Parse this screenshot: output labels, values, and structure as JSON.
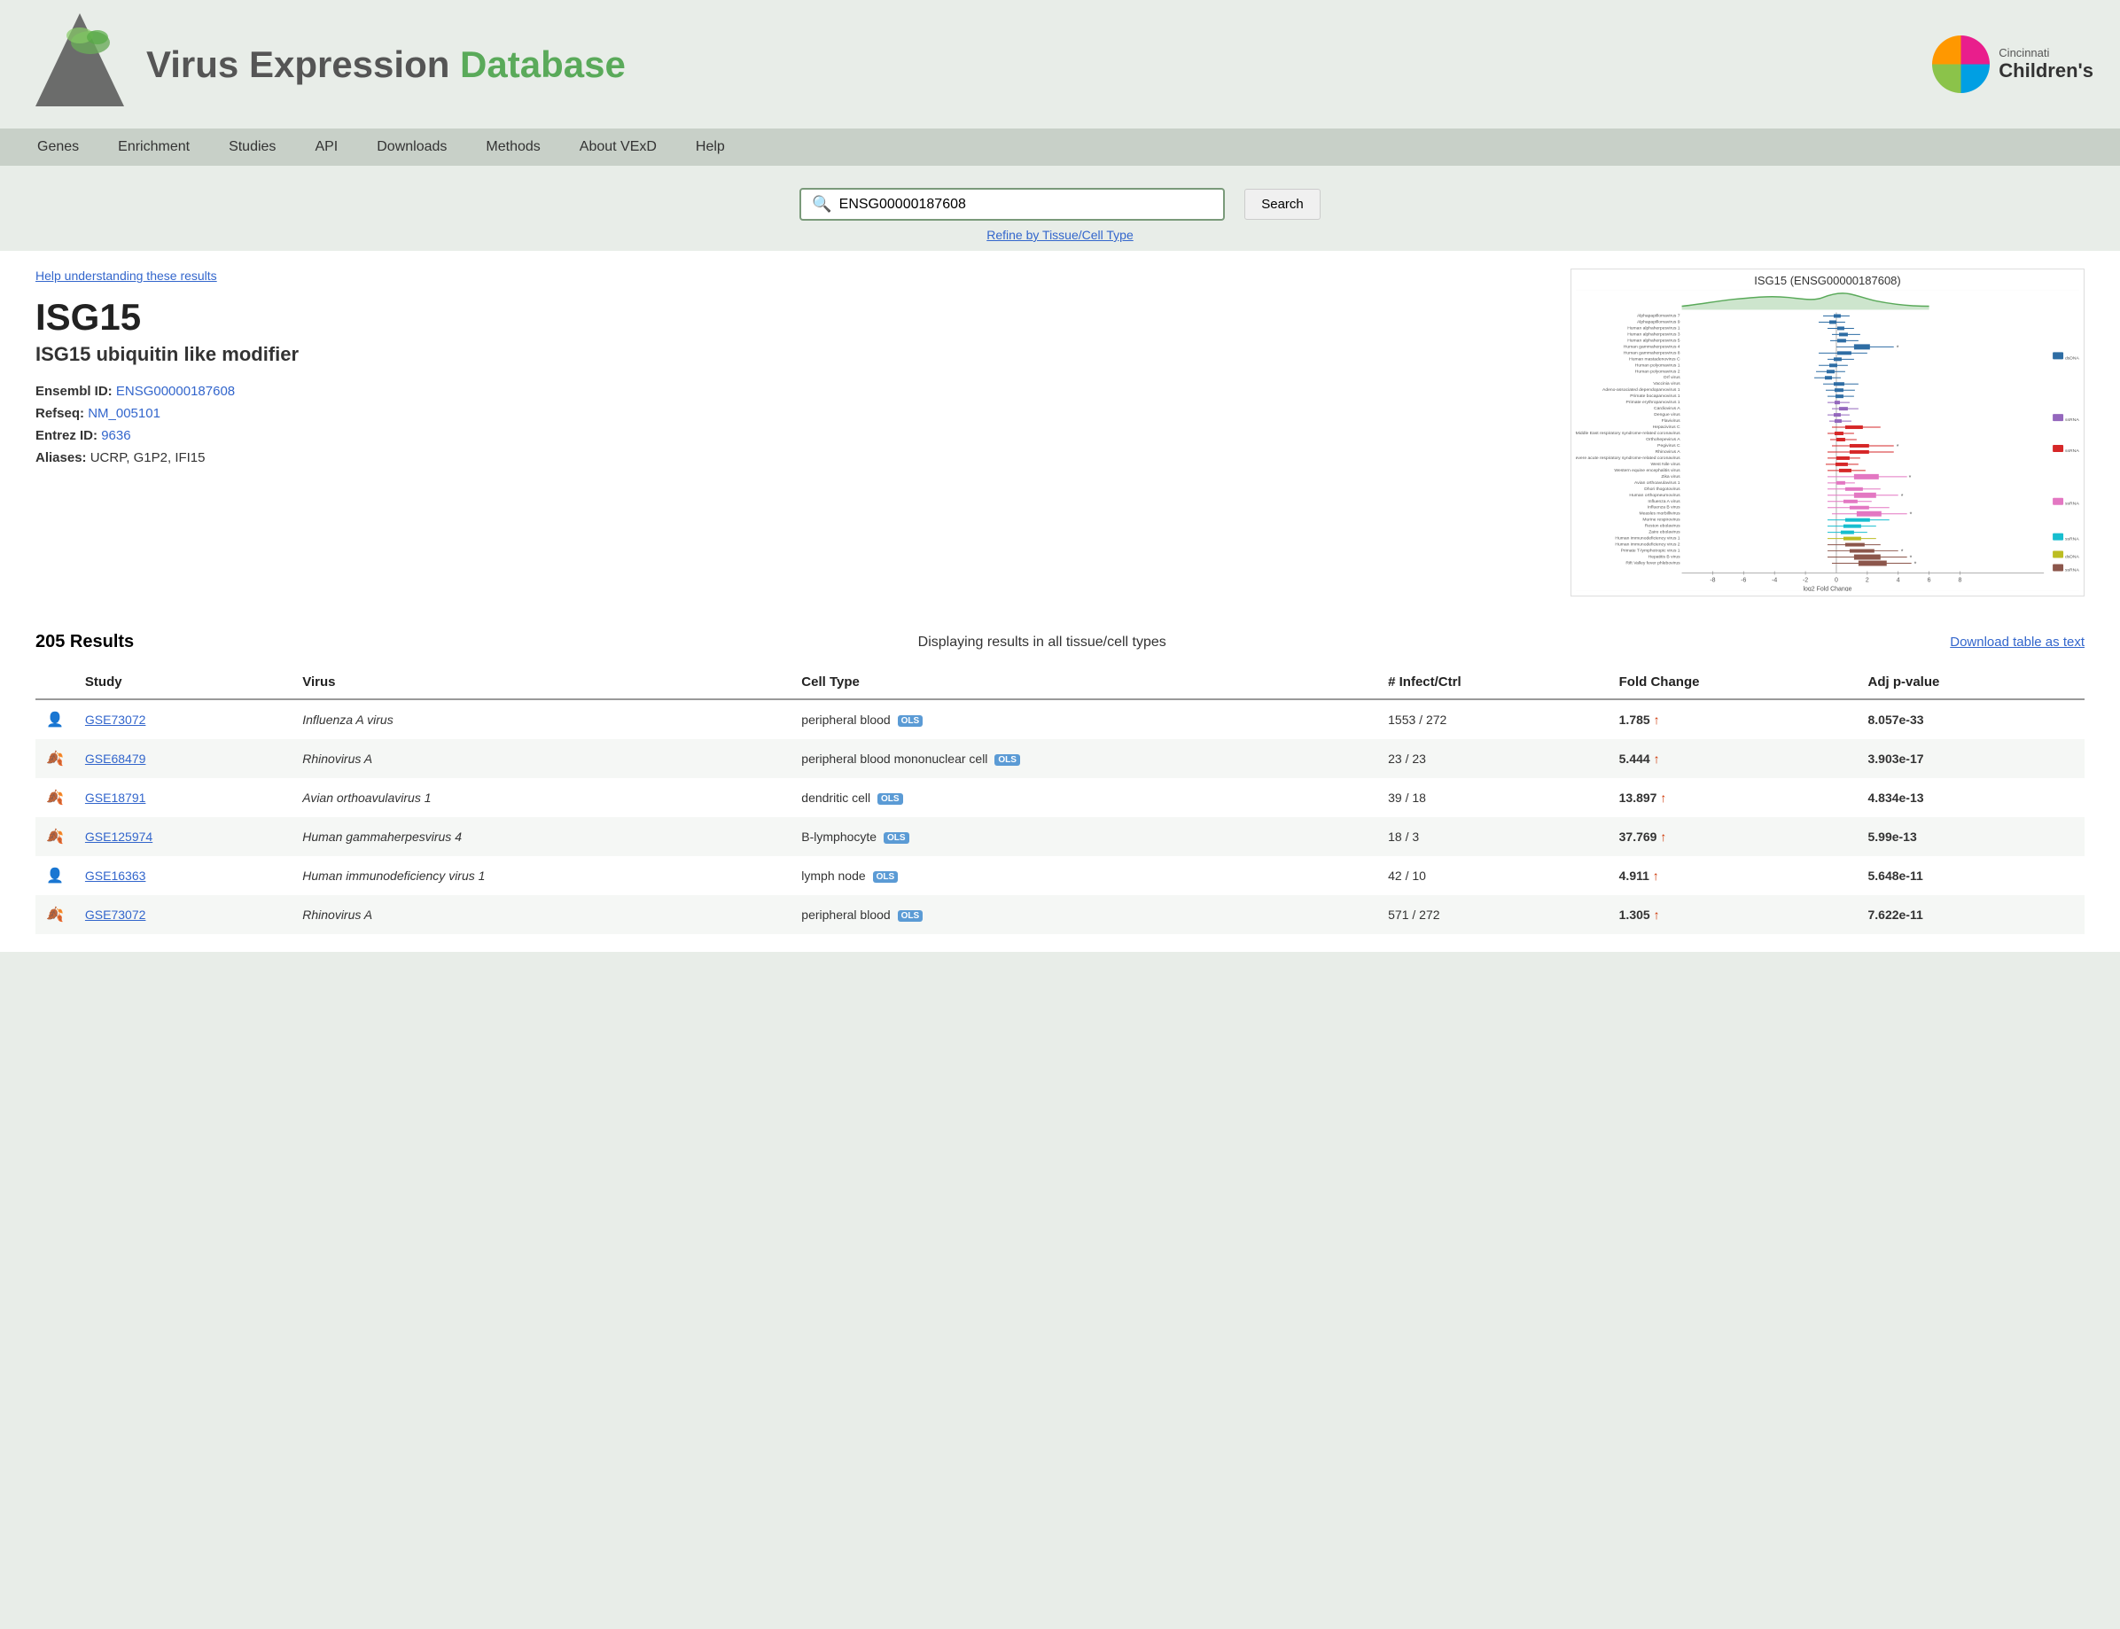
{
  "header": {
    "site_title_prefix": "Virus Expression ",
    "site_title_suffix": "Database",
    "institution": "Cincinnati",
    "institution_sub": "Children's"
  },
  "nav": {
    "items": [
      {
        "label": "Genes",
        "href": "#"
      },
      {
        "label": "Enrichment",
        "href": "#"
      },
      {
        "label": "Studies",
        "href": "#"
      },
      {
        "label": "API",
        "href": "#"
      },
      {
        "label": "Downloads",
        "href": "#"
      },
      {
        "label": "Methods",
        "href": "#"
      },
      {
        "label": "About VExD",
        "href": "#"
      },
      {
        "label": "Help",
        "href": "#"
      }
    ]
  },
  "search": {
    "placeholder": "ENSG00000187608",
    "value": "ENSG00000187608",
    "button_label": "Search",
    "refine_label": "Refine by Tissue/Cell Type"
  },
  "gene": {
    "help_link": "Help understanding these results",
    "name": "ISG15",
    "description": "ISG15 ubiquitin like modifier",
    "ensembl_label": "Ensembl ID:",
    "ensembl_value": "ENSG00000187608",
    "refseq_label": "Refseq:",
    "refseq_value": "NM_005101",
    "entrez_label": "Entrez ID:",
    "entrez_value": "9636",
    "aliases_label": "Aliases:",
    "aliases_value": "UCRP, G1P2, IFI15"
  },
  "chart": {
    "title": "ISG15 (ENSG00000187608)"
  },
  "results": {
    "count": "205 Results",
    "display_text": "Displaying results in all tissue/cell types",
    "download_label": "Download table as text",
    "columns": [
      "Study",
      "Virus",
      "Cell Type",
      "# Infect/Ctrl",
      "Fold Change",
      "Adj p-value"
    ],
    "rows": [
      {
        "icon": "human",
        "study": "GSE73072",
        "virus": "Influenza A virus",
        "cell_type": "peripheral blood",
        "ols": true,
        "infect_ctrl": "1553 / 272",
        "fold_change": "1.785",
        "direction": "up",
        "adj_p": "8.057e-33",
        "row_class": "odd"
      },
      {
        "icon": "leaf",
        "study": "GSE68479",
        "virus": "Rhinovirus A",
        "cell_type": "peripheral blood mononuclear cell",
        "ols": true,
        "infect_ctrl": "23 / 23",
        "fold_change": "5.444",
        "direction": "up",
        "adj_p": "3.903e-17",
        "row_class": "even"
      },
      {
        "icon": "leaf",
        "study": "GSE18791",
        "virus": "Avian orthoavulavirus 1",
        "cell_type": "dendritic cell",
        "ols": true,
        "infect_ctrl": "39 / 18",
        "fold_change": "13.897",
        "direction": "up",
        "adj_p": "4.834e-13",
        "row_class": "odd"
      },
      {
        "icon": "leaf",
        "study": "GSE125974",
        "virus": "Human gammaherpesvirus 4",
        "cell_type": "B-lymphocyte",
        "ols": true,
        "infect_ctrl": "18 / 3",
        "fold_change": "37.769",
        "direction": "up",
        "adj_p": "5.99e-13",
        "row_class": "even"
      },
      {
        "icon": "human",
        "study": "GSE16363",
        "virus": "Human immunodeficiency virus 1",
        "cell_type": "lymph node",
        "ols": true,
        "infect_ctrl": "42 / 10",
        "fold_change": "4.911",
        "direction": "up",
        "adj_p": "5.648e-11",
        "row_class": "odd"
      },
      {
        "icon": "leaf",
        "study": "GSE73072",
        "virus": "Rhinovirus A",
        "cell_type": "peripheral blood",
        "ols": true,
        "infect_ctrl": "571 / 272",
        "fold_change": "1.305",
        "direction": "up",
        "adj_p": "7.622e-11",
        "row_class": "even"
      }
    ]
  }
}
